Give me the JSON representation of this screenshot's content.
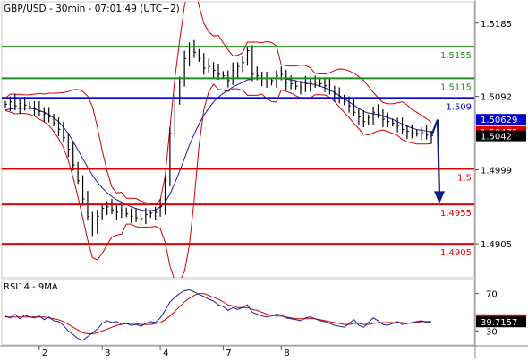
{
  "header": {
    "title": "GBP/USD - 30min - 07:01:49 (UTC+2)"
  },
  "colors": {
    "resistance": "#1e8c1e",
    "pivot": "#0000cc",
    "support": "#e00000",
    "bollinger": "#cc0000",
    "moving_average": "#1a1aa0",
    "price_bars": "#000000",
    "arrow": "#0b1e78",
    "rsi_ma": "#cc0000",
    "rsi": "#1a1aa0",
    "tag_ma_red": "#e00000",
    "tag_ma_blue": "#0000cc",
    "tag_last": "#000000"
  },
  "chart_data": [
    {
      "type": "line",
      "series_type": "candlestick",
      "axis": {
        "ylim": [
          1.4862,
          1.5212
        ],
        "y_ticks": [
          "1.5185",
          "1.5092",
          "1.4999",
          "1.4905"
        ],
        "y_tick_values": [
          1.5185,
          1.5092,
          1.4999,
          1.4905
        ],
        "x_ticks": [
          "2",
          "3",
          "4",
          "7",
          "8"
        ],
        "x_tick_positions": [
          7,
          20,
          32,
          45,
          57
        ]
      },
      "levels": [
        {
          "kind": "resistance",
          "value": 1.5155,
          "label": "1.5155"
        },
        {
          "kind": "resistance",
          "value": 1.5115,
          "label": "1.5115"
        },
        {
          "kind": "pivot",
          "value": 1.509,
          "label": "1.509"
        },
        {
          "kind": "support",
          "value": 1.5,
          "label": "1.5"
        },
        {
          "kind": "support",
          "value": 1.4955,
          "label": "1.4955"
        },
        {
          "kind": "support",
          "value": 1.4905,
          "label": "1.4905"
        }
      ],
      "value_tags": [
        {
          "text": "1.50629",
          "value": 1.50629,
          "color_key": "tag_ma_blue"
        },
        {
          "text": "1.50475",
          "value": 1.50475,
          "color_key": "tag_ma_red"
        },
        {
          "text": "1.5042",
          "value": 1.5042,
          "color_key": "tag_last"
        }
      ],
      "close": [
        1.5082,
        1.5085,
        1.508,
        1.5083,
        1.5081,
        1.5079,
        1.5076,
        1.5073,
        1.507,
        1.5066,
        1.5058,
        1.505,
        1.504,
        1.5025,
        1.5005,
        1.4985,
        1.4962,
        1.494,
        1.4925,
        1.494,
        1.495,
        1.4952,
        1.4948,
        1.4945,
        1.4947,
        1.4943,
        1.494,
        1.4938,
        1.4937,
        1.4942,
        1.4944,
        1.4945,
        1.4952,
        1.4985,
        1.5045,
        1.509,
        1.511,
        1.514,
        1.5155,
        1.5148,
        1.514,
        1.5128,
        1.513,
        1.5125,
        1.512,
        1.5118,
        1.5112,
        1.5125,
        1.513,
        1.5135,
        1.515,
        1.512,
        1.5118,
        1.5115,
        1.511,
        1.5112,
        1.5118,
        1.512,
        1.511,
        1.5108,
        1.5105,
        1.5103,
        1.5108,
        1.511,
        1.511,
        1.5108,
        1.5106,
        1.51,
        1.5095,
        1.509,
        1.5085,
        1.508,
        1.5072,
        1.5066,
        1.506,
        1.5065,
        1.5072,
        1.507,
        1.5063,
        1.506,
        1.5058,
        1.5055,
        1.505,
        1.5048,
        1.5046,
        1.5045,
        1.5046,
        1.5043,
        1.5042
      ],
      "ma": [
        1.5075,
        1.5076,
        1.5077,
        1.5077,
        1.5077,
        1.5077,
        1.5076,
        1.5074,
        1.5072,
        1.5069,
        1.5065,
        1.506,
        1.5053,
        1.5045,
        1.5035,
        1.5024,
        1.5013,
        1.5002,
        1.4992,
        1.4983,
        1.4976,
        1.497,
        1.4965,
        1.4961,
        1.4958,
        1.4955,
        1.4952,
        1.495,
        1.4948,
        1.4947,
        1.4947,
        1.4948,
        1.4952,
        1.4958,
        1.4968,
        1.4982,
        1.4997,
        1.5013,
        1.503,
        1.5044,
        1.5057,
        1.5068,
        1.5077,
        1.5085,
        1.5091,
        1.5096,
        1.51,
        1.5104,
        1.5107,
        1.511,
        1.5113,
        1.5114,
        1.5115,
        1.5115,
        1.5115,
        1.5115,
        1.5115,
        1.5115,
        1.5114,
        1.5113,
        1.5112,
        1.511,
        1.5109,
        1.5108,
        1.5107,
        1.5105,
        1.5103,
        1.51,
        1.5097,
        1.5093,
        1.5089,
        1.5085,
        1.5081,
        1.5077,
        1.5073,
        1.5071,
        1.507,
        1.5069,
        1.5067,
        1.5065,
        1.5063,
        1.506,
        1.5057,
        1.5054,
        1.5052,
        1.505,
        1.5049,
        1.5048,
        1.5047
      ]
    },
    {
      "type": "line",
      "title": "RSI14 - 9MA",
      "axis": {
        "ylim": [
          15,
          85
        ],
        "y_ticks": [
          "70",
          "30"
        ],
        "y_tick_values": [
          70,
          30
        ]
      },
      "value_tags": [
        {
          "text": "42.033",
          "value": 42.033,
          "color_key": "rsi_ma"
        },
        {
          "text": "39.7157",
          "value": 39.7157,
          "color_key": "tag_last"
        }
      ],
      "rsi": [
        46,
        44,
        48,
        43,
        47,
        45,
        44,
        46,
        42,
        45,
        41,
        40,
        36,
        30,
        26,
        22,
        20,
        24,
        28,
        32,
        38,
        41,
        39,
        40,
        37,
        38,
        36,
        37,
        35,
        38,
        40,
        39,
        44,
        52,
        61,
        66,
        70,
        73,
        74,
        72,
        69,
        67,
        64,
        62,
        58,
        56,
        52,
        55,
        53,
        55,
        58,
        50,
        48,
        46,
        45,
        46,
        48,
        47,
        44,
        43,
        42,
        41,
        44,
        45,
        43,
        41,
        40,
        38,
        36,
        35,
        34,
        38,
        42,
        36,
        34,
        39,
        44,
        41,
        37,
        36,
        38,
        40,
        37,
        38,
        39,
        40,
        41,
        39,
        40
      ],
      "ma": [
        45,
        45,
        45,
        45,
        45,
        45,
        45,
        45,
        45,
        44,
        43,
        42,
        40,
        37,
        34,
        31,
        28,
        27,
        27,
        28,
        30,
        32,
        34,
        36,
        37,
        38,
        38,
        38,
        37,
        37,
        37,
        38,
        39,
        42,
        46,
        51,
        56,
        61,
        65,
        68,
        70,
        70,
        68,
        66,
        64,
        61,
        58,
        57,
        55,
        55,
        55,
        53,
        52,
        50,
        48,
        47,
        46,
        46,
        45,
        44,
        43,
        43,
        43,
        43,
        43,
        42,
        41,
        40,
        39,
        38,
        37,
        37,
        38,
        38,
        37,
        37,
        38,
        39,
        39,
        39,
        39,
        39,
        39,
        38,
        39,
        39,
        40,
        40,
        40
      ]
    }
  ]
}
